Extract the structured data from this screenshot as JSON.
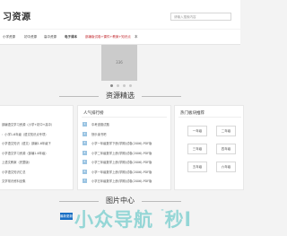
{
  "header": {
    "site_title": "习资源",
    "search_placeholder": "请输入搜索内容"
  },
  "nav": {
    "items": [
      {
        "label": "小学资源",
        "style": "normal"
      },
      {
        "label": "初中资源",
        "style": "normal"
      },
      {
        "label": "高中资源",
        "style": "normal"
      },
      {
        "label": "电子课本",
        "style": "strong"
      },
      {
        "label": "部编版试卷+课件+教案+知识点",
        "style": "red"
      },
      {
        "label": "本",
        "style": "normal"
      }
    ]
  },
  "banner": {
    "label": "336"
  },
  "sections": {
    "resources_title": "资源精选",
    "picture_title": "图片中心"
  },
  "left_panel": {
    "items": [
      "部编语文学习资源（小学+初中+高中）",
      "：小学1-6年级（语文知识点专项）",
      "小学语文知识（语文）部编1-6年级下",
      "小学语文学习资源（部编1-6年级）",
      "上语文教案（完整版）",
      "小学语文知识汇总",
      "文学常识资料全集"
    ]
  },
  "hot_panel": {
    "title": "人气排行榜",
    "items": [
      {
        "num": "1",
        "text": "中考道德试题"
      },
      {
        "num": "2",
        "text": "快乐读书吧"
      },
      {
        "num": "3",
        "text": "小学一年级数学下册(学期)试卷(2006)-PDF版"
      },
      {
        "num": "4",
        "text": "小学二年级数学上册(学期)试卷(2006)-PDF版"
      },
      {
        "num": "5",
        "text": "小学三年级数学上册(学期)试卷(2006)-PDF版"
      },
      {
        "num": "6",
        "text": "小学一年级数学上册(学期)试卷(2006)-PDF版"
      },
      {
        "num": "7",
        "text": "小学五年级数学上册(学期)试卷(2006)-PDF版"
      }
    ]
  },
  "cat_panel": {
    "title": "热门板块推荐",
    "cells": [
      "一年级",
      "二年级",
      "三年级",
      "四年级",
      "五年级",
      "六年级"
    ]
  },
  "picture_tab": {
    "label": "最新更新"
  },
  "watermark": {
    "text": "小众导航",
    "suffix": "秒l"
  },
  "colors": {
    "accent_blue": "#1a6fc4",
    "nav_red": "#c0252b",
    "hot_badge": "#9bc4e2"
  }
}
